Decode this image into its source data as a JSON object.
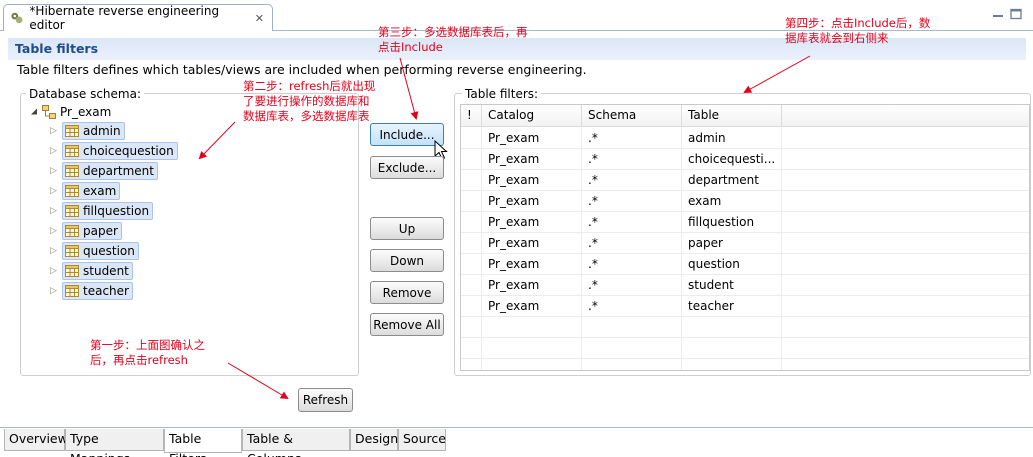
{
  "editor_tab": {
    "title": "*Hibernate reverse engineering editor",
    "close": "✕"
  },
  "header": {
    "title": "Table filters",
    "description": "Table filters defines which tables/views are included when performing reverse engineering."
  },
  "schema_panel": {
    "label": "Database schema:",
    "root": "Pr_exam",
    "tables": [
      "admin",
      "choicequestion",
      "department",
      "exam",
      "fillquestion",
      "paper",
      "question",
      "student",
      "teacher"
    ]
  },
  "buttons": {
    "include": "Include...",
    "exclude": "Exclude...",
    "up": "Up",
    "down": "Down",
    "remove": "Remove",
    "remove_all": "Remove All",
    "refresh": "Refresh"
  },
  "filters_panel": {
    "label": "Table filters:",
    "columns": [
      "!",
      "Catalog",
      "Schema",
      "Table"
    ],
    "rows": [
      [
        "",
        "Pr_exam",
        ".*",
        "admin"
      ],
      [
        "",
        "Pr_exam",
        ".*",
        "choicequesti..."
      ],
      [
        "",
        "Pr_exam",
        ".*",
        "department"
      ],
      [
        "",
        "Pr_exam",
        ".*",
        "exam"
      ],
      [
        "",
        "Pr_exam",
        ".*",
        "fillquestion"
      ],
      [
        "",
        "Pr_exam",
        ".*",
        "paper"
      ],
      [
        "",
        "Pr_exam",
        ".*",
        "question"
      ],
      [
        "",
        "Pr_exam",
        ".*",
        "student"
      ],
      [
        "",
        "Pr_exam",
        ".*",
        "teacher"
      ]
    ]
  },
  "bottom_tabs": [
    "Overview",
    "Type Mappings",
    "Table Filters",
    "Table & Columns",
    "Design",
    "Source"
  ],
  "active_bottom_tab": "Table Filters",
  "annotations": {
    "step1": [
      "第一步：上面图确认之",
      "后，再点击refresh"
    ],
    "step2": [
      "第二步：refresh后就出现",
      "了要进行操作的数据库和",
      "数据库表，多选数据库表"
    ],
    "step3": [
      "第三步：多选数据库表后，再",
      "点击Include"
    ],
    "step4": [
      "第四步：点击Include后，数",
      "据库表就会到右侧来"
    ]
  },
  "colors": {
    "annotation": "#e4001b",
    "header_title": "#1f4c8f",
    "selection": "#dbe7f7"
  }
}
